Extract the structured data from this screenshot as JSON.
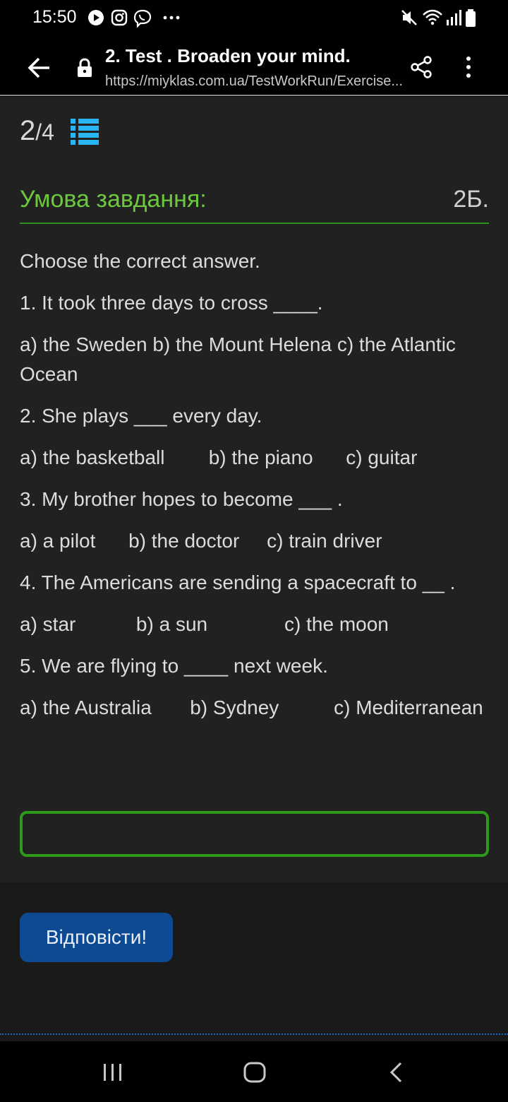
{
  "status_bar": {
    "time": "15:50",
    "left_icons": [
      "play-icon",
      "instagram-icon",
      "viber-icon",
      "more-notifications-icon"
    ],
    "right_icons": [
      "mute-icon",
      "wifi-icon",
      "signal-icon",
      "battery-icon"
    ]
  },
  "browser": {
    "title": "2. Test . Broaden your mind.",
    "url": "https://miyklas.com.ua/TestWorkRun/Exercise..."
  },
  "progress": {
    "current": "2",
    "total": "/4"
  },
  "condition": {
    "title": "Умова завдання:",
    "points": "2Б."
  },
  "task": {
    "instruction": "Choose the correct answer.",
    "questions": [
      {
        "text": "1. It took three days to cross ____.",
        "options": "a) the Sweden       b) the Mount Helena        c) the Atlantic Ocean"
      },
      {
        "text": "2. She plays ___ every day.",
        "options": "a) the basketball        b) the piano      c) guitar"
      },
      {
        "text": "3. My brother hopes to become ___ .",
        "options": "a) a pilot      b) the doctor     c) train driver"
      },
      {
        "text": "4. The Americans are sending a spacecraft to __ .",
        "options": "a) star           b) a sun              c) the moon"
      },
      {
        "text": "5. We are flying to ____ next week.",
        "options": "a) the Australia       b) Sydney          c) Mediterranean"
      }
    ]
  },
  "answer_input": {
    "value": "",
    "placeholder": ""
  },
  "submit": {
    "label": "Відповісти!"
  },
  "colors": {
    "accent_green": "#6ec83e",
    "border_green": "#2e9a1c",
    "button_blue": "#0d4a91",
    "list_icon_blue": "#29b6f6"
  }
}
